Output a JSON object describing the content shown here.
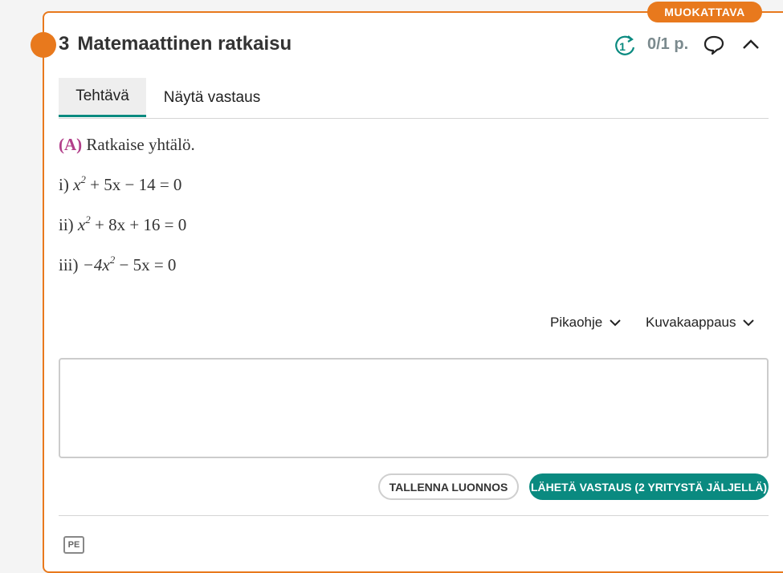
{
  "badge": "MUOKATTAVA",
  "header": {
    "number": "3",
    "title": "Matemaattinen ratkaisu",
    "retry_count": "1",
    "points": "0/1 p."
  },
  "tabs": [
    {
      "label": "Tehtävä",
      "active": true
    },
    {
      "label": "Näytä vastaus",
      "active": false
    }
  ],
  "question": {
    "label": "(A)",
    "text": "Ratkaise yhtälö.",
    "items": [
      {
        "prefix": "i)",
        "lhs": "x",
        "exp": "2",
        "rest": "+ 5x − 14 = 0"
      },
      {
        "prefix": "ii)",
        "lhs": "x",
        "exp": "2",
        "rest": "+ 8x + 16 = 0"
      },
      {
        "prefix": "iii)",
        "lhs": "−4x",
        "exp": "2",
        "rest": "− 5x = 0"
      }
    ]
  },
  "tools": {
    "quick_help": "Pikaohje",
    "screenshot": "Kuvakaappaus"
  },
  "buttons": {
    "save_draft": "TALLENNA LUONNOS",
    "submit": "LÄHETÄ VASTAUS (2 YRITYSTÄ JÄLJELLÄ)"
  },
  "footer_icon_label": "PE",
  "colors": {
    "accent_orange": "#e8791d",
    "accent_teal": "#0a8a80",
    "label_magenta": "#b23f8a"
  }
}
